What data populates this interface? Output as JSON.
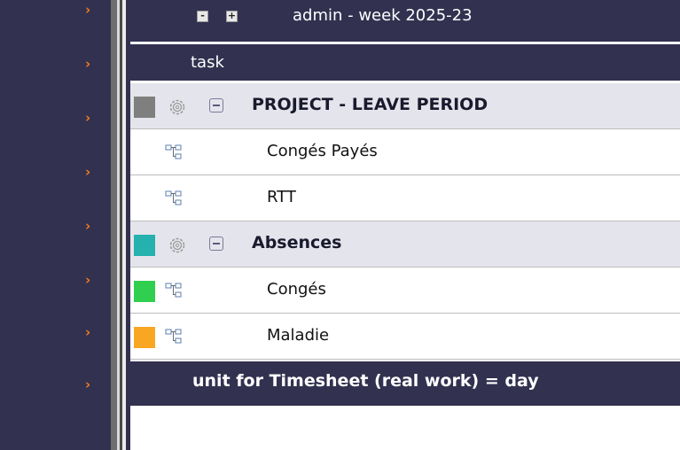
{
  "header": {
    "collapse_label": "-",
    "expand_label": "+",
    "title": "admin - week 2025-23"
  },
  "task_header": "task",
  "groups": [
    {
      "label": "PROJECT - LEAVE PERIOD",
      "color": "#7f7f7f",
      "items": [
        {
          "label": "Congés Payés",
          "color": ""
        },
        {
          "label": "RTT",
          "color": ""
        }
      ]
    },
    {
      "label": "Absences",
      "color": "#25b1ad",
      "items": [
        {
          "label": "Congés",
          "color": "#30cf4f"
        },
        {
          "label": "Maladie",
          "color": "#f9a623"
        }
      ]
    }
  ],
  "footer": "unit for Timesheet (real work) = day",
  "nav_icon": "chevron-right-icon",
  "accent": "#f07c1c"
}
